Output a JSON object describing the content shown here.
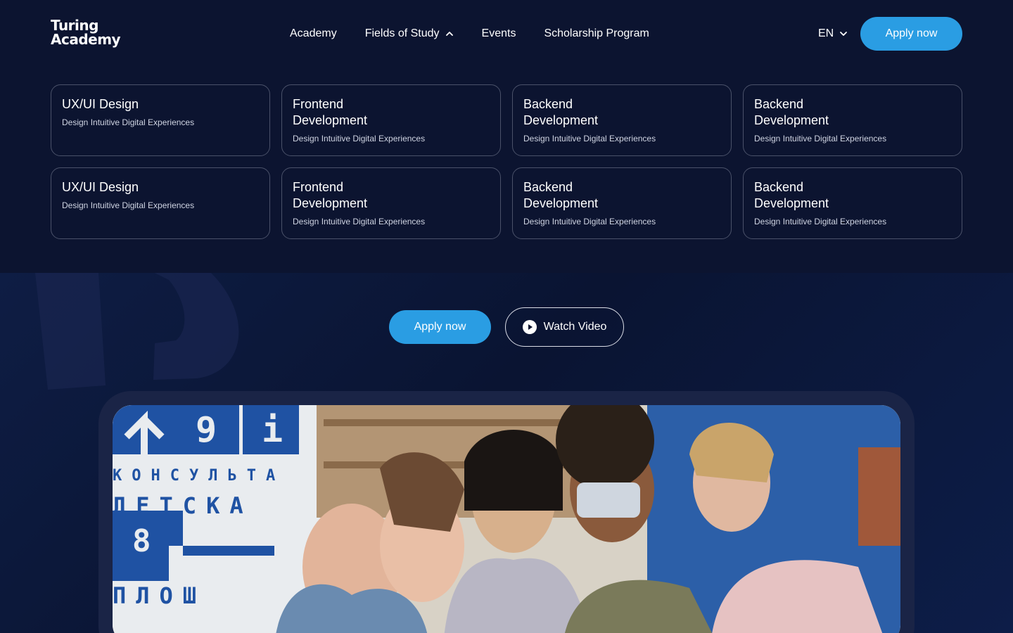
{
  "brand": {
    "line1": "Turing",
    "line2": "Academy"
  },
  "nav": {
    "items": [
      {
        "label": "Academy"
      },
      {
        "label": "Fields of Study"
      },
      {
        "label": "Events"
      },
      {
        "label": "Scholarship Program"
      }
    ]
  },
  "language": {
    "selected": "EN"
  },
  "header": {
    "apply_label": "Apply now"
  },
  "fields": [
    {
      "title": "UX/UI Design",
      "subtitle": "Design Intuitive Digital Experiences"
    },
    {
      "title": "Frontend Development",
      "subtitle": "Design Intuitive Digital Experiences"
    },
    {
      "title": "Backend Development",
      "subtitle": "Design Intuitive Digital Experiences"
    },
    {
      "title": "Backend Development",
      "subtitle": "Design Intuitive Digital Experiences"
    },
    {
      "title": "UX/UI Design",
      "subtitle": "Design Intuitive Digital Experiences"
    },
    {
      "title": "Frontend Development",
      "subtitle": "Design Intuitive Digital Experiences"
    },
    {
      "title": "Backend Development",
      "subtitle": "Design Intuitive Digital Experiences"
    },
    {
      "title": "Backend Development",
      "subtitle": "Design Intuitive Digital Experiences"
    }
  ],
  "hero": {
    "apply_label": "Apply now",
    "watch_label": "Watch Video",
    "photo": {
      "sign_lines": [
        "КОНСУЛЬТА",
        "ДЕТСКА",
        "ПЛОШ"
      ],
      "sign_numbers": [
        "9",
        "i",
        "8"
      ]
    }
  },
  "colors": {
    "accent": "#2a9de3",
    "background": "#0c1430",
    "card_border": "#4a5169"
  },
  "icons": {
    "nav_chevron": "chevron-up-icon",
    "lang_chevron": "chevron-down-icon",
    "watch": "play-circle-icon"
  }
}
